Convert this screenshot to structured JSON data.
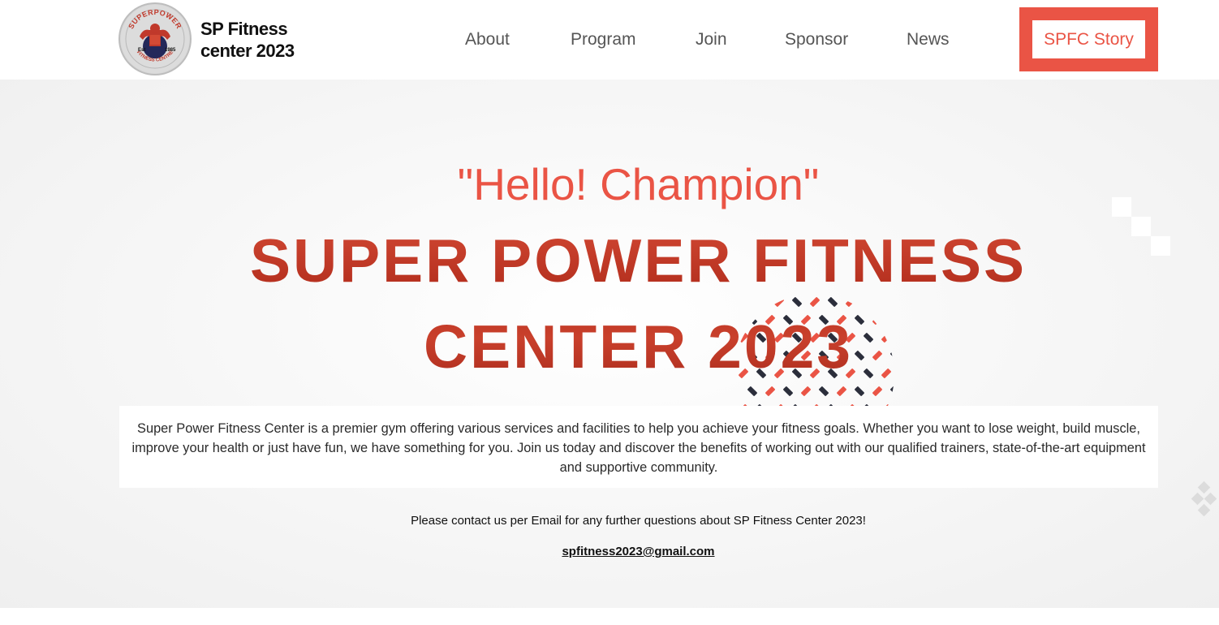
{
  "header": {
    "site_title": "SP Fitness center 2023",
    "logo": {
      "icon": "superpower-logo",
      "arc_text_top": "SUPERPOWER",
      "arc_text_bottom": "FITNESS CENTRE",
      "est_label": "Est",
      "est_year": "1985"
    },
    "nav": [
      {
        "label": "About"
      },
      {
        "label": "Program"
      },
      {
        "label": "Join"
      },
      {
        "label": "Sponsor"
      },
      {
        "label": "News"
      }
    ],
    "cta_label": "SPFC Story"
  },
  "hero": {
    "greeting": "\"Hello! Champion\"",
    "title_line1": "SUPER POWER FITNESS",
    "title_line2": "CENTER 2023",
    "description": "Super Power Fitness Center is a premier gym offering various services and facilities to help you achieve your fitness goals. Whether you want to lose weight, build muscle, improve your health or just have fun, we have something for you. Join us today and discover the benefits of working out with our qualified trainers, state-of-the-art equipment and supportive community.",
    "contact_text": "Please contact us per Email for any further questions about SP Fitness Center 2023!",
    "email": "spfitness2023@gmail.com"
  },
  "colors": {
    "accent": "#ea5445",
    "title_red": "#c0392b",
    "nav_text": "#555555",
    "pattern_dark": "#2b2e3b"
  }
}
